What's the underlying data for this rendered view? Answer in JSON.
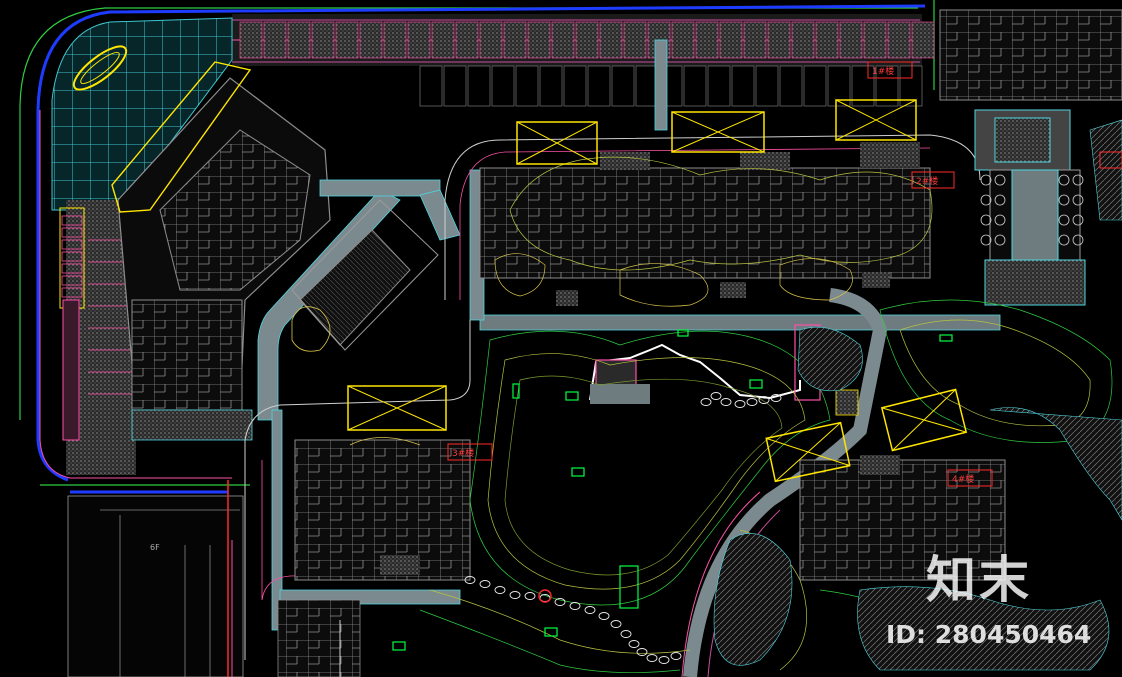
{
  "watermark": {
    "brand": "知末",
    "id_text": "ID: 280450464"
  },
  "floor_label": "6F",
  "building_labels": [
    "1#楼",
    "2#楼",
    "3#楼",
    "4#楼"
  ],
  "colors": {
    "background": "#000000",
    "paving_cyan": "#4fd6e0",
    "road_boundary_blue": "#1e3cff",
    "parking_magenta": "#ff4fa8",
    "placeholder_yellow": "#ffe600",
    "label_red": "#ff2a2a",
    "contour_green": "#2ecc40",
    "building_gray": "#9a9a9a",
    "plant_green": "#00ff44"
  }
}
